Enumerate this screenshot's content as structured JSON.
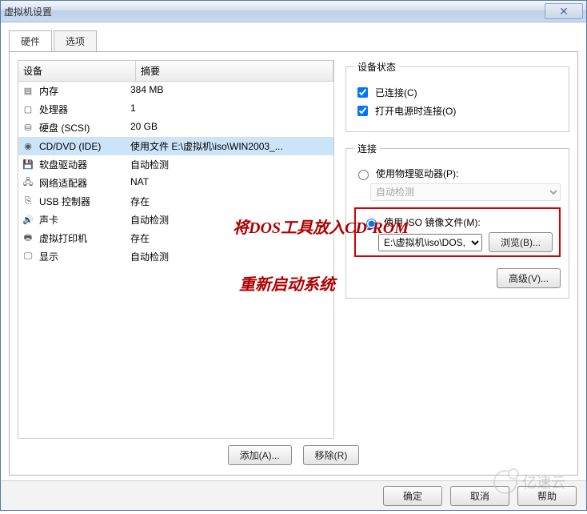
{
  "window": {
    "title": "虚拟机设置"
  },
  "tabs": {
    "hardware": "硬件",
    "options": "选项"
  },
  "list": {
    "header_device": "设备",
    "header_summary": "摘要",
    "rows": [
      {
        "icon": "memory-icon",
        "device": "内存",
        "summary": "384 MB"
      },
      {
        "icon": "cpu-icon",
        "device": "处理器",
        "summary": "1"
      },
      {
        "icon": "disk-icon",
        "device": "硬盘 (SCSI)",
        "summary": "20 GB"
      },
      {
        "icon": "cd-icon",
        "device": "CD/DVD (IDE)",
        "summary": "使用文件 E:\\虚拟机\\iso\\WIN2003_..."
      },
      {
        "icon": "floppy-icon",
        "device": "软盘驱动器",
        "summary": "自动检测"
      },
      {
        "icon": "network-icon",
        "device": "网络适配器",
        "summary": "NAT"
      },
      {
        "icon": "usb-icon",
        "device": "USB 控制器",
        "summary": "存在"
      },
      {
        "icon": "sound-icon",
        "device": "声卡",
        "summary": "自动检测"
      },
      {
        "icon": "printer-icon",
        "device": "虚拟打印机",
        "summary": "存在"
      },
      {
        "icon": "display-icon",
        "device": "显示",
        "summary": "自动检测"
      }
    ],
    "selected": 3
  },
  "status": {
    "legend": "设备状态",
    "connected": "已连接(C)",
    "connect_power_on": "打开电源时连接(O)"
  },
  "connection": {
    "legend": "连接",
    "use_physical": "使用物理驱动器(P):",
    "auto_detect": "自动检测",
    "use_iso": "使用 ISO 镜像文件(M):",
    "iso_path": "E:\\虚拟机\\iso\\DOS,",
    "browse": "浏览(B)...",
    "advanced": "高级(V)..."
  },
  "annotations": {
    "line1": "将DOS工具放入CD-ROM",
    "line2": "重新启动系统"
  },
  "bottom": {
    "add": "添加(A)...",
    "remove": "移除(R)"
  },
  "footer": {
    "ok": "确定",
    "cancel": "取消",
    "help": "帮助"
  },
  "watermark": "亿速云"
}
